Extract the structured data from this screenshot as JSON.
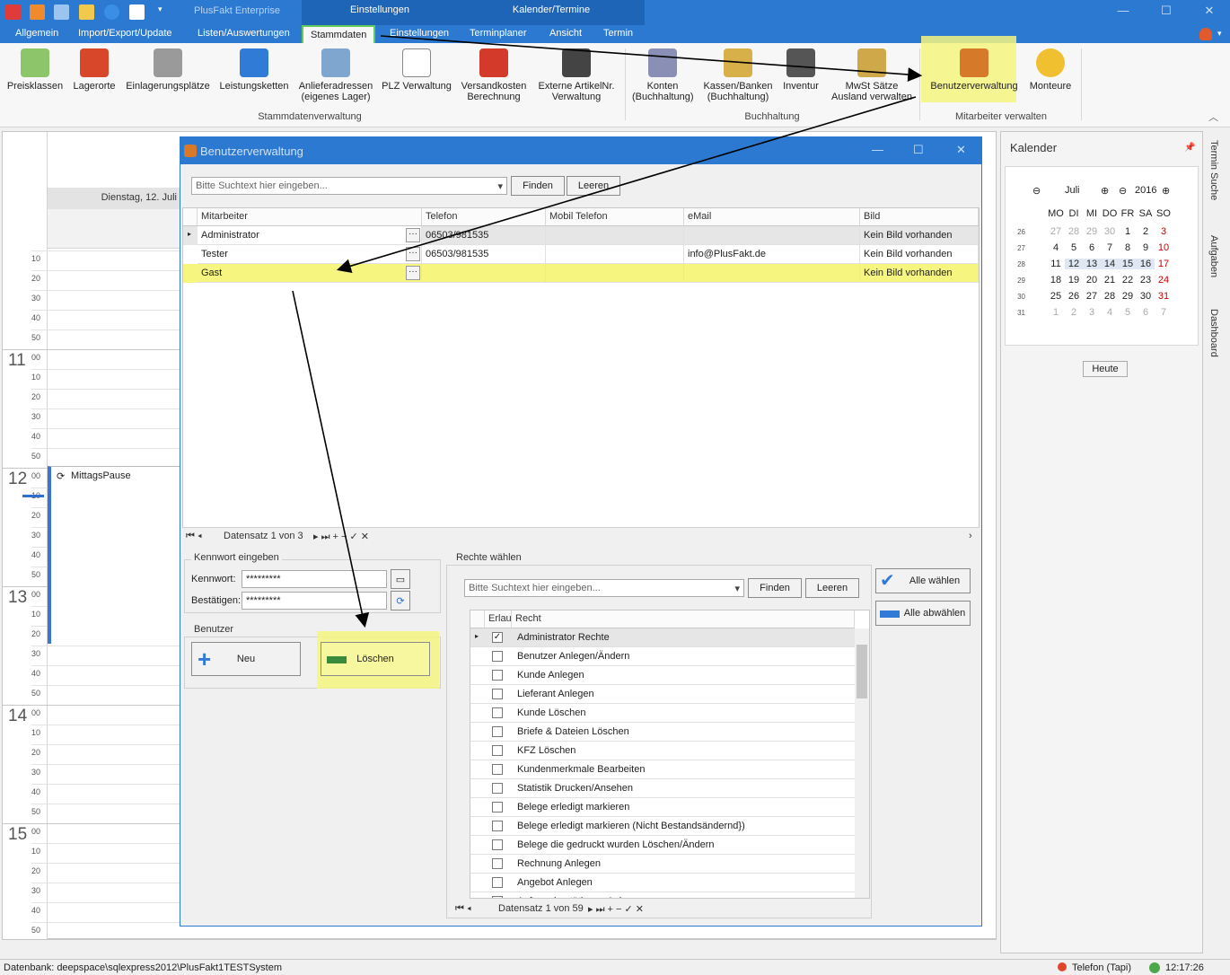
{
  "app": {
    "title": "PlusFakt Enterprise",
    "context_groups": [
      "Einstellungen",
      "Kalender/Termine"
    ]
  },
  "tabs": [
    "Allgemein",
    "Import/Export/Update",
    "Listen/Auswertungen",
    "Stammdaten",
    "Einstellungen",
    "Terminplaner",
    "Ansicht",
    "Termin"
  ],
  "ribbon": {
    "buttons": [
      {
        "label": "Preisklassen"
      },
      {
        "label": "Lagerorte"
      },
      {
        "label": "Einlagerungsplätze"
      },
      {
        "label": "Leistungsketten"
      },
      {
        "label": "Anlieferadressen\n(eigenes Lager)"
      },
      {
        "label": "PLZ Verwaltung"
      },
      {
        "label": "Versandkosten\nBerechnung"
      },
      {
        "label": "Externe ArtikelNr.\nVerwaltung"
      },
      {
        "label": "Konten\n(Buchhaltung)"
      },
      {
        "label": "Kassen/Banken\n(Buchhaltung)"
      },
      {
        "label": "Inventur"
      },
      {
        "label": "MwSt Sätze\nAusland verwalten"
      },
      {
        "label": "Benutzerverwaltung"
      },
      {
        "label": "Monteure"
      }
    ],
    "groups": [
      "Stammdatenverwaltung",
      "Buchhaltung",
      "Mitarbeiter verwalten"
    ]
  },
  "calendar": {
    "day_header": "Dienstag, 12. Juli",
    "hours": [
      "11",
      "12",
      "13",
      "14",
      "15"
    ],
    "minutes": [
      "10",
      "20",
      "30",
      "40",
      "50",
      "00"
    ],
    "event": "MittagsPause"
  },
  "kalender": {
    "title": "Kalender",
    "month": "Juli",
    "year": "2016",
    "weekdays": [
      "MO",
      "DI",
      "MI",
      "DO",
      "FR",
      "SA",
      "SO"
    ],
    "weeks": [
      {
        "wk": "26",
        "days": [
          "26",
          "27",
          "28",
          "29",
          "30",
          "1",
          "2",
          "3"
        ]
      },
      {
        "wk": "27",
        "days": [
          "4",
          "5",
          "6",
          "7",
          "8",
          "9",
          "10"
        ]
      },
      {
        "wk": "28",
        "days": [
          "11",
          "12",
          "13",
          "14",
          "15",
          "16",
          "17"
        ]
      },
      {
        "wk": "29",
        "days": [
          "18",
          "19",
          "20",
          "21",
          "22",
          "23",
          "24"
        ]
      },
      {
        "wk": "30",
        "days": [
          "25",
          "26",
          "27",
          "28",
          "29",
          "30",
          "31"
        ]
      },
      {
        "wk": "31",
        "days": [
          "1",
          "2",
          "3",
          "4",
          "5",
          "6",
          "7"
        ]
      }
    ],
    "today_button": "Heute",
    "side_tabs": [
      "Termin Suche",
      "Aufgaben",
      "Dashboard"
    ]
  },
  "dialog": {
    "title": "Benutzerverwaltung",
    "search_placeholder": "Bitte Suchtext hier eingeben...",
    "find": "Finden",
    "clear": "Leeren",
    "columns": [
      "Mitarbeiter",
      "Telefon",
      "Mobil Telefon",
      "eMail",
      "Bild"
    ],
    "rows": [
      {
        "name": "Administrator",
        "tel": "06503/981535",
        "mobil": "",
        "email": "",
        "bild": "Kein Bild vorhanden"
      },
      {
        "name": "Tester",
        "tel": "06503/981535",
        "mobil": "",
        "email": "info@PlusFakt.de",
        "bild": "Kein Bild vorhanden"
      },
      {
        "name": "Gast",
        "tel": "",
        "mobil": "",
        "email": "",
        "bild": "Kein Bild vorhanden"
      }
    ],
    "record_nav": "Datensatz 1 von 3",
    "kennwort_group": "Kennwort eingeben",
    "kennwort_label": "Kennwort:",
    "bestaetigen_label": "Bestätigen:",
    "kennwort_value": "*********",
    "bestaetigen_value": "*********",
    "benutzer_group": "Benutzer",
    "neu": "Neu",
    "loeschen": "Löschen",
    "rechte_group": "Rechte wählen",
    "alle_waehlen": "Alle wählen",
    "alle_abwaehlen": "Alle abwählen",
    "rechte_columns": [
      "Erlau...",
      "Recht"
    ],
    "rechte": [
      {
        "checked": true,
        "label": "Administrator Rechte"
      },
      {
        "checked": false,
        "label": "Benutzer Anlegen/Ändern"
      },
      {
        "checked": false,
        "label": "Kunde Anlegen"
      },
      {
        "checked": false,
        "label": "Lieferant Anlegen"
      },
      {
        "checked": false,
        "label": "Kunde Löschen"
      },
      {
        "checked": false,
        "label": "Briefe & Dateien Löschen"
      },
      {
        "checked": false,
        "label": "KFZ Löschen"
      },
      {
        "checked": false,
        "label": "Kundenmerkmale Bearbeiten"
      },
      {
        "checked": false,
        "label": "Statistik Drucken/Ansehen"
      },
      {
        "checked": false,
        "label": "Belege erledigt markieren"
      },
      {
        "checked": false,
        "label": "Belege erledigt markieren (Nicht Bestandsändernd})"
      },
      {
        "checked": false,
        "label": "Belege die gedruckt wurden Löschen/Ändern"
      },
      {
        "checked": false,
        "label": "Rechnung Anlegen"
      },
      {
        "checked": false,
        "label": "Angebot Anlegen"
      },
      {
        "checked": false,
        "label": "Auftragsbestätigung Anlegen"
      }
    ],
    "rechte_nav": "Datensatz 1 von 59"
  },
  "status": {
    "db": "Datenbank: deepspace\\sqlexpress2012\\PlusFakt1TESTSystem",
    "phone": "Telefon (Tapi)",
    "time": "12:17:26"
  },
  "colors": {
    "titlebar": "#2b79d0",
    "highlight": "#f5f580",
    "accent_green": "#62c95a"
  }
}
